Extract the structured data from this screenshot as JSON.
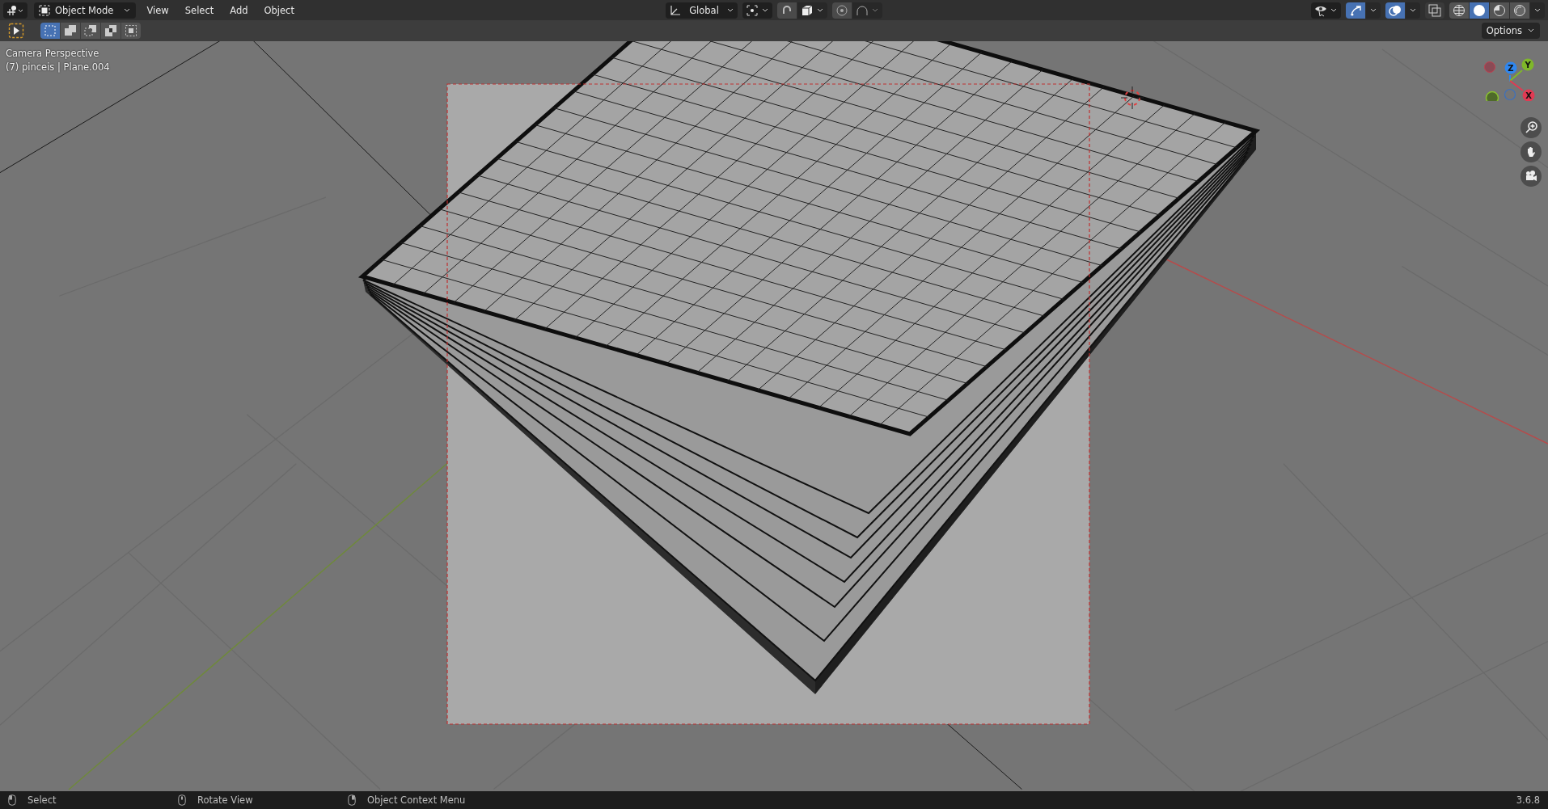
{
  "header": {
    "mode": {
      "label": "Object Mode"
    },
    "menus": [
      {
        "label": "View"
      },
      {
        "label": "Select"
      },
      {
        "label": "Add"
      },
      {
        "label": "Object"
      }
    ],
    "orientation": {
      "label": "Global"
    },
    "toggles": [
      {
        "kind": "snap",
        "on": false
      },
      {
        "kind": "proportional",
        "on": false
      },
      {
        "kind": "gizmos",
        "on": true
      },
      {
        "kind": "overlays",
        "on": true
      },
      {
        "kind": "xray",
        "on": false
      }
    ],
    "shading_modes": [
      {
        "kind": "wireframe",
        "selected": false
      },
      {
        "kind": "solid",
        "selected": true
      },
      {
        "kind": "material",
        "selected": false
      },
      {
        "kind": "rendered",
        "selected": false
      }
    ]
  },
  "tool_header": {
    "select_modes": [
      {
        "kind": "set",
        "selected": true
      },
      {
        "kind": "extend",
        "selected": false
      },
      {
        "kind": "subtract",
        "selected": false
      },
      {
        "kind": "invert",
        "selected": false
      },
      {
        "kind": "intersect",
        "selected": false
      }
    ],
    "options": "Options"
  },
  "viewport": {
    "info": [
      "Camera Perspective",
      "(7) pinceis | Plane.004"
    ],
    "axes": [
      {
        "label": "Z",
        "color": "#2f87f0"
      },
      {
        "label": "Y",
        "color": "#7fb72a"
      },
      {
        "label": "X",
        "color": "#e23a53"
      }
    ]
  },
  "status_bar": {
    "hints": [
      {
        "kind": "left",
        "label": "Select"
      },
      {
        "kind": "middle",
        "label": "Rotate View"
      },
      {
        "kind": "right",
        "label": "Object Context Menu"
      }
    ],
    "version": "3.6.8"
  }
}
